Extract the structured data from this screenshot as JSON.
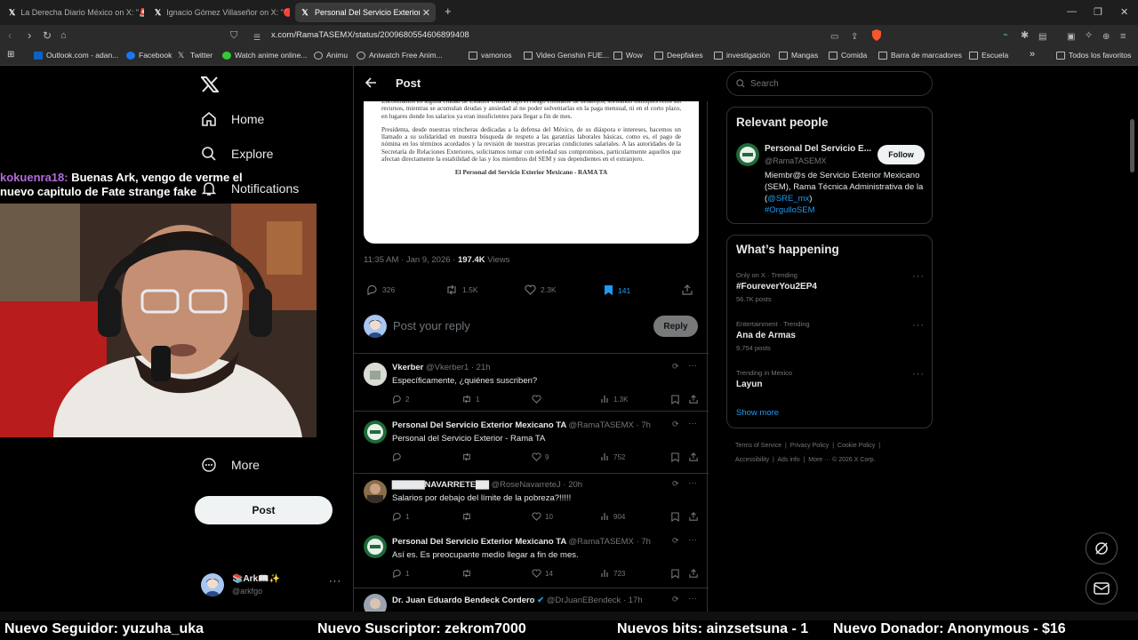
{
  "browser": {
    "tabs": [
      {
        "title": "La Derecha Diario México on X: \"🚨",
        "active": false
      },
      {
        "title": "Ignacio Gómez Villaseñor on X: \"🔴",
        "active": false
      },
      {
        "title": "Personal Del Servicio Exterior Me",
        "active": true
      }
    ],
    "url": "x.com/RamaTASEMX/status/2009680554606899408",
    "bookmarks": [
      "Outlook.com - adan...",
      "Facebook",
      "Twitter",
      "Watch anime online...",
      "Animu",
      "Aniwatch Free Anim...",
      "vamonos",
      "Video Genshin FUE...",
      "Wow",
      "Deepfakes",
      "investigación",
      "Mangas",
      "Comida",
      "Barra de marcadores",
      "Escuela"
    ],
    "all_favorites": "Todos los favoritos"
  },
  "sidebar": {
    "nav": [
      {
        "label": "Home",
        "icon": "home-icon"
      },
      {
        "label": "Explore",
        "icon": "search-icon"
      },
      {
        "label": "Notifications",
        "icon": "bell-icon"
      }
    ],
    "more_label": "More",
    "post_button": "Post",
    "account": {
      "name": "📚Ark📖✨",
      "handle": "@arkfgo"
    }
  },
  "overlay": {
    "chat": {
      "user": "kokuenra18:",
      "message": "Buenas Ark, vengo de verme el nuevo capitulo de Fate strange fake"
    },
    "ticker": {
      "follower": "Nuevo Seguidor: yuzuha_uka",
      "subscriber": "Nuevo Suscriptor: zekrom7000",
      "bits": "Nuevos bits: ainzsetsuna - 1",
      "donor": "Nuevo Donador: Anonymous - $16"
    }
  },
  "post": {
    "header": "Post",
    "document": {
      "paragraph1": "Encontramos en alguna ciudad de Estados Unidos bajo el riesgo constante de desalojos, sorteando múltiples retos sin recursos, mientras se acumulan deudas y ansiedad al no poder solventarlas en la paga mensual, ni en el corto plazo, en lugares donde los salarios ya eran insuficientes para llegar a fin de mes.",
      "paragraph2": "Presidenta, desde nuestras trincheras dedicadas a la defensa del México, de su diáspora e intereses, hacemos un llamado a su solidaridad en nuestra búsqueda de respeto a las garantías laborales básicas, como es, el pago de nómina en los términos acordados y la revisión de nuestras precarias condiciones salariales. A las autoridades de la Secretaría de Relaciones Exteriores, solicitamos tomar con seriedad sus compromisos, particularmente aquellos que afectan directamente la estabilidad de las y los miembros del SEM y sus dependientes en el extranjero.",
      "signature": "El Personal del Servicio Exterior Mexicano - RAMA TA"
    },
    "timestamp": "11:35 AM · Jan 9, 2026 · ",
    "views": "197.4K",
    "views_label": " Views",
    "stats": {
      "replies": "326",
      "reposts": "1.5K",
      "likes": "2.3K",
      "bookmarks": "141"
    },
    "reply_placeholder": "Post your reply",
    "reply_button": "Reply"
  },
  "replies": [
    {
      "name": "Vkerber",
      "handle": "@Vkerber1 · 21h",
      "text": "Específicamente, ¿quiénes suscriben?",
      "replies": "2",
      "reposts": "1",
      "likes": "",
      "views": "1.3K"
    },
    {
      "name": "Personal Del Servicio Exterior Mexicano TA",
      "handle": "@RamaTASEMX · 7h",
      "text": "Personal del Servicio Exterior - Rama TA",
      "replies": "",
      "reposts": "",
      "likes": "9",
      "views": "752"
    },
    {
      "name": "▇▇▇▇▇NAVARRETE▇▇",
      "handle": "@RoseNavarreteJ · 20h",
      "text": "Salarios por debajo del límite de la pobreza?!!!!!",
      "replies": "1",
      "reposts": "",
      "likes": "10",
      "views": "904"
    },
    {
      "name": "Personal Del Servicio Exterior Mexicano TA",
      "handle": "@RamaTASEMX · 7h",
      "text": "Así es. Es preocupante medio llegar a fin de mes.",
      "replies": "1",
      "reposts": "",
      "likes": "14",
      "views": "723"
    },
    {
      "name": "Dr. Juan Eduardo Bendeck Cordero",
      "handle": "@DrJuanEBendeck · 17h",
      "text": "",
      "replies": "",
      "reposts": "",
      "likes": "",
      "views": ""
    }
  ],
  "right": {
    "search_placeholder": "Search",
    "relevant_title": "Relevant people",
    "person": {
      "name": "Personal Del Servicio E...",
      "handle": "@RamaTASEMX",
      "follow": "Follow",
      "bio_text": "Miembr@s de Servicio Exterior Mexicano (SEM), Rama Técnica Administrativa de la (",
      "bio_link": "@SRE_mx",
      "bio_close": ")",
      "bio_tag": "#OrgulloSEM"
    },
    "happening_title": "What’s happening",
    "trends": [
      {
        "meta": "Only on X · Trending",
        "name": "#FoureverYou2EP4",
        "posts": "56.7K posts"
      },
      {
        "meta": "Entertainment · Trending",
        "name": "Ana de Armas",
        "posts": "9,754 posts"
      },
      {
        "meta": "Trending in Mexico",
        "name": "Layun",
        "posts": ""
      }
    ],
    "show_more": "Show more",
    "footer": [
      "Terms of Service",
      "Privacy Policy",
      "Cookie Policy",
      "Accessibility",
      "Ads info",
      "More ···",
      "© 2026 X Corp."
    ]
  },
  "colors": {
    "accent": "#1d9bf0",
    "background": "#000000",
    "border": "#2f3336",
    "muted": "#71767b",
    "chat_name": "#b06cd9"
  }
}
